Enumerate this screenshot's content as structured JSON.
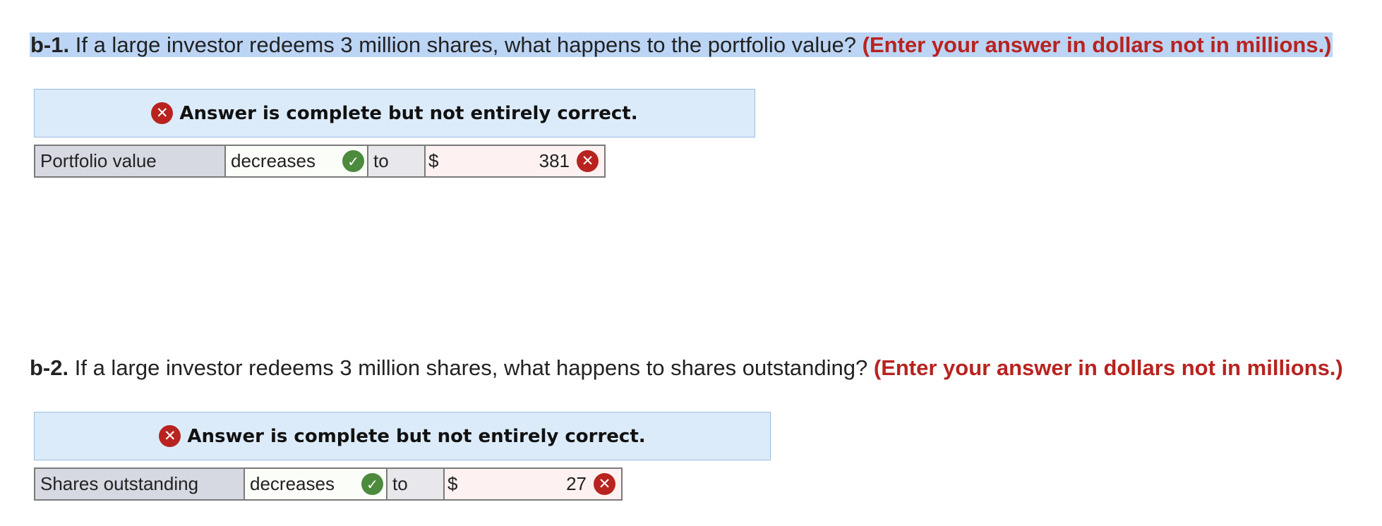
{
  "q1": {
    "number": "b-1.",
    "text": " If a large investor redeems 3 million shares, what happens to the portfolio value? ",
    "instruction": "(Enter your answer in dollars not in millions.)"
  },
  "feedback1": {
    "message": "Answer is complete but not entirely correct."
  },
  "row1": {
    "label": "Portfolio value",
    "selection": "decreases",
    "connector": "to",
    "currency": "$",
    "amount": "381"
  },
  "q2": {
    "number": "b-2.",
    "text": " If a large investor redeems 3 million shares, what happens to shares outstanding? ",
    "instruction": "(Enter your answer in dollars not in millions.)"
  },
  "feedback2": {
    "message": "Answer is complete but not entirely correct."
  },
  "row2": {
    "label": "Shares outstanding",
    "selection": "decreases",
    "connector": "to",
    "currency": "$",
    "amount": "27"
  },
  "icons": {
    "incorrect_glyph": "✕",
    "correct_glyph": "✓"
  },
  "colors": {
    "incorrect": "#b8231f",
    "correct": "#4c8a3d",
    "feedback_bg": "#dcebf9",
    "highlight": "#bcd5f5"
  }
}
